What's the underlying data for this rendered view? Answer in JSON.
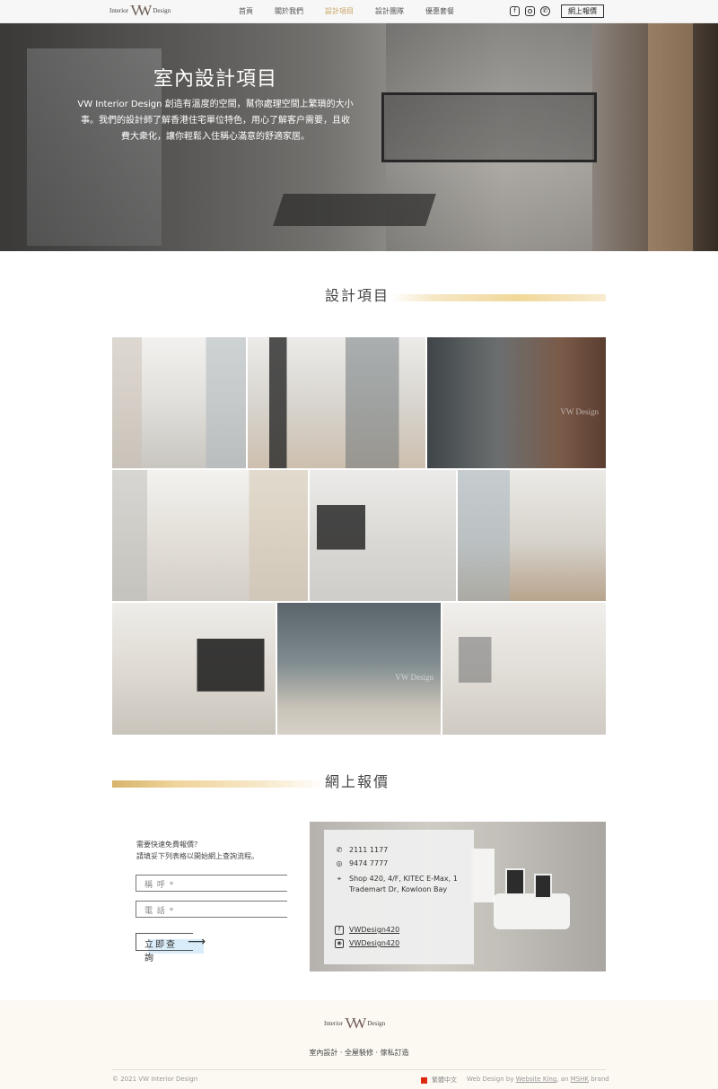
{
  "nav": {
    "logo_left": "Interior",
    "logo_mark": "VW",
    "logo_right": "Design",
    "links": [
      "首頁",
      "關於我們",
      "設計項目",
      "設計團隊",
      "優惠套餐"
    ],
    "active_index": 2,
    "social_icons": [
      "facebook-icon",
      "instagram-icon",
      "whatsapp-icon"
    ],
    "cta_label": "網上報價"
  },
  "hero": {
    "title": "室內設計項目",
    "subtitle": "VW Interior Design 創造有溫度的空間，幫你處理空間上繁瑣的大小事。我們的設計師了解香港住宅單位特色，用心了解客户需要，且收費大衆化，讓你輕鬆入住稱心滿意的舒適家居。"
  },
  "projects": {
    "title": "設計項目",
    "watermark": "VW Design",
    "images": [
      "project-1",
      "project-2",
      "project-3",
      "project-4",
      "project-5",
      "project-6",
      "project-7",
      "project-8",
      "project-9"
    ]
  },
  "quote": {
    "title": "網上報價",
    "intro_line1": "需要快速免費報價？",
    "intro_line2": "請填妥下列表格以開始網上查詢流程。",
    "name_placeholder": "稱 呼 *",
    "phone_placeholder": "電 話 *",
    "submit_label": "立即查詢",
    "submit_arrow": "⟶",
    "phone": "2111 1177",
    "whatsapp": "9474 7777",
    "address_line1": "Shop 420, 4/F, KITEC E-Max, 1",
    "address_line2": "Trademart Dr, Kowloon Bay",
    "facebook": "VWDesign420",
    "instagram": "VWDesign420"
  },
  "footer": {
    "logo_left": "Interior",
    "logo_mark": "VW",
    "logo_right": "Design",
    "tagline": "室內設計 · 全屋裝修 · 傢私訂造",
    "copyright": "© 2021 VW Interior Design",
    "language": "繁體中文",
    "credit_prefix": "Web Design by",
    "credit_link": "Website King",
    "credit_mid": ", an",
    "credit_brand": "MSHK",
    "credit_suffix": "brand"
  },
  "colors": {
    "accent_gold": "#c8a15e",
    "footer_bg": "#fcf9f2"
  }
}
